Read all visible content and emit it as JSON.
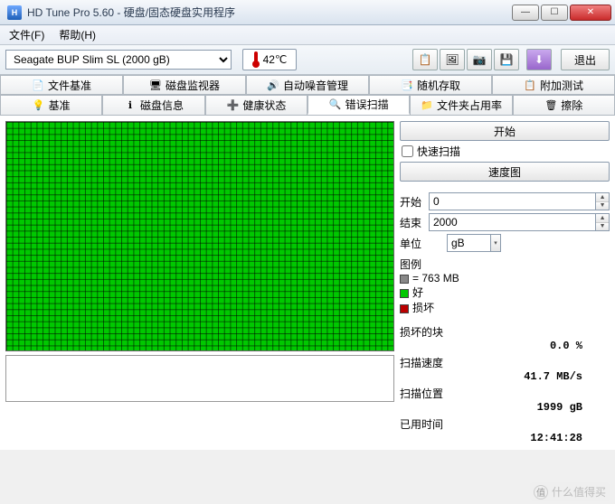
{
  "window": {
    "title": "HD Tune Pro 5.60 - 硬盘/固态硬盘实用程序"
  },
  "menu": {
    "file": "文件(F)",
    "help": "帮助(H)"
  },
  "toolbar": {
    "disk": "Seagate BUP Slim SL (2000 gB)",
    "temp": "42℃",
    "exit": "退出"
  },
  "tabs": {
    "row1": [
      {
        "label": "文件基准",
        "icon": "📄"
      },
      {
        "label": "磁盘监视器",
        "icon": "🖥"
      },
      {
        "label": "自动噪音管理",
        "icon": "🔊"
      },
      {
        "label": "随机存取",
        "icon": "📑"
      },
      {
        "label": "附加测试",
        "icon": "📋"
      }
    ],
    "row2": [
      {
        "label": "基准",
        "icon": "💡"
      },
      {
        "label": "磁盘信息",
        "icon": "ℹ"
      },
      {
        "label": "健康状态",
        "icon": "➕"
      },
      {
        "label": "错误扫描",
        "icon": "🔍",
        "active": true
      },
      {
        "label": "文件夹占用率",
        "icon": "📁"
      },
      {
        "label": "擦除",
        "icon": "🗑"
      }
    ]
  },
  "side": {
    "start": "开始",
    "quick": "快速扫描",
    "speedmap": "速度图",
    "startLabel": "开始",
    "startVal": "0",
    "endLabel": "结束",
    "endVal": "2000",
    "unitLabel": "单位",
    "unitVal": "gB",
    "legendTitle": "图例",
    "legendBlock": "= 763 MB",
    "legendGood": "好",
    "legendBad": "损坏",
    "damagedLabel": "损坏的块",
    "damagedVal": "0.0 %",
    "speedLabel": "扫描速度",
    "speedVal": "41.7 MB/s",
    "posLabel": "扫描位置",
    "posVal": "1999 gB",
    "timeLabel": "已用时间",
    "timeVal": "12:41:28"
  },
  "watermark": "什么值得买"
}
